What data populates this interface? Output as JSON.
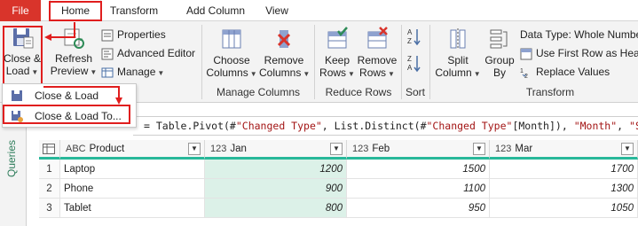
{
  "menu": {
    "file": "File",
    "home": "Home",
    "transform": "Transform",
    "add_column": "Add Column",
    "view": "View"
  },
  "ribbon": {
    "close_load": {
      "line1": "Close &",
      "line2": "Load"
    },
    "refresh_preview": {
      "line1": "Refresh",
      "line2": "Preview"
    },
    "properties": "Properties",
    "advanced_editor": "Advanced Editor",
    "manage": "Manage",
    "choose_columns": {
      "line1": "Choose",
      "line2": "Columns"
    },
    "remove_columns": {
      "line1": "Remove",
      "line2": "Columns"
    },
    "group_manage_columns": "Manage Columns",
    "keep_rows": {
      "line1": "Keep",
      "line2": "Rows"
    },
    "remove_rows": {
      "line1": "Remove",
      "line2": "Rows"
    },
    "group_reduce_rows": "Reduce Rows",
    "group_sort": "Sort",
    "split_column": {
      "line1": "Split",
      "line2": "Column"
    },
    "group_by": {
      "line1": "Group",
      "line2": "By"
    },
    "data_type": "Data Type: Whole Number",
    "use_first_row": "Use First Row as Headers",
    "replace_values": "Replace Values",
    "group_transform": "Transform"
  },
  "dropdown": {
    "items": [
      "Close & Load",
      "Close & Load To..."
    ]
  },
  "formula": {
    "prefix": "= Table.Pivot(#",
    "s1": "\"Changed Type\"",
    "mid1": ", List.Distinct(#",
    "s2": "\"Changed Type\"",
    "mid2": "[Month]), ",
    "s3": "\"Month\"",
    "mid3": ", ",
    "s4": "\"Sales\""
  },
  "sidebar": {
    "queries": "Queries"
  },
  "table": {
    "columns": [
      {
        "type": "ABC",
        "name": "Product"
      },
      {
        "type": "123",
        "name": "Jan"
      },
      {
        "type": "123",
        "name": "Feb"
      },
      {
        "type": "123",
        "name": "Mar"
      }
    ],
    "rows": [
      {
        "idx": "1",
        "product": "Laptop",
        "jan": "1200",
        "feb": "1500",
        "mar": "1700"
      },
      {
        "idx": "2",
        "product": "Phone",
        "jan": "900",
        "feb": "1100",
        "mar": "1300"
      },
      {
        "idx": "3",
        "product": "Tablet",
        "jan": "800",
        "feb": "950",
        "mar": "1050"
      }
    ]
  },
  "colors": {
    "file_tab": "#d9342b",
    "highlight": "#e01e1e",
    "header_accent": "#28b89a",
    "jan_fill": "#dcf1e8"
  }
}
